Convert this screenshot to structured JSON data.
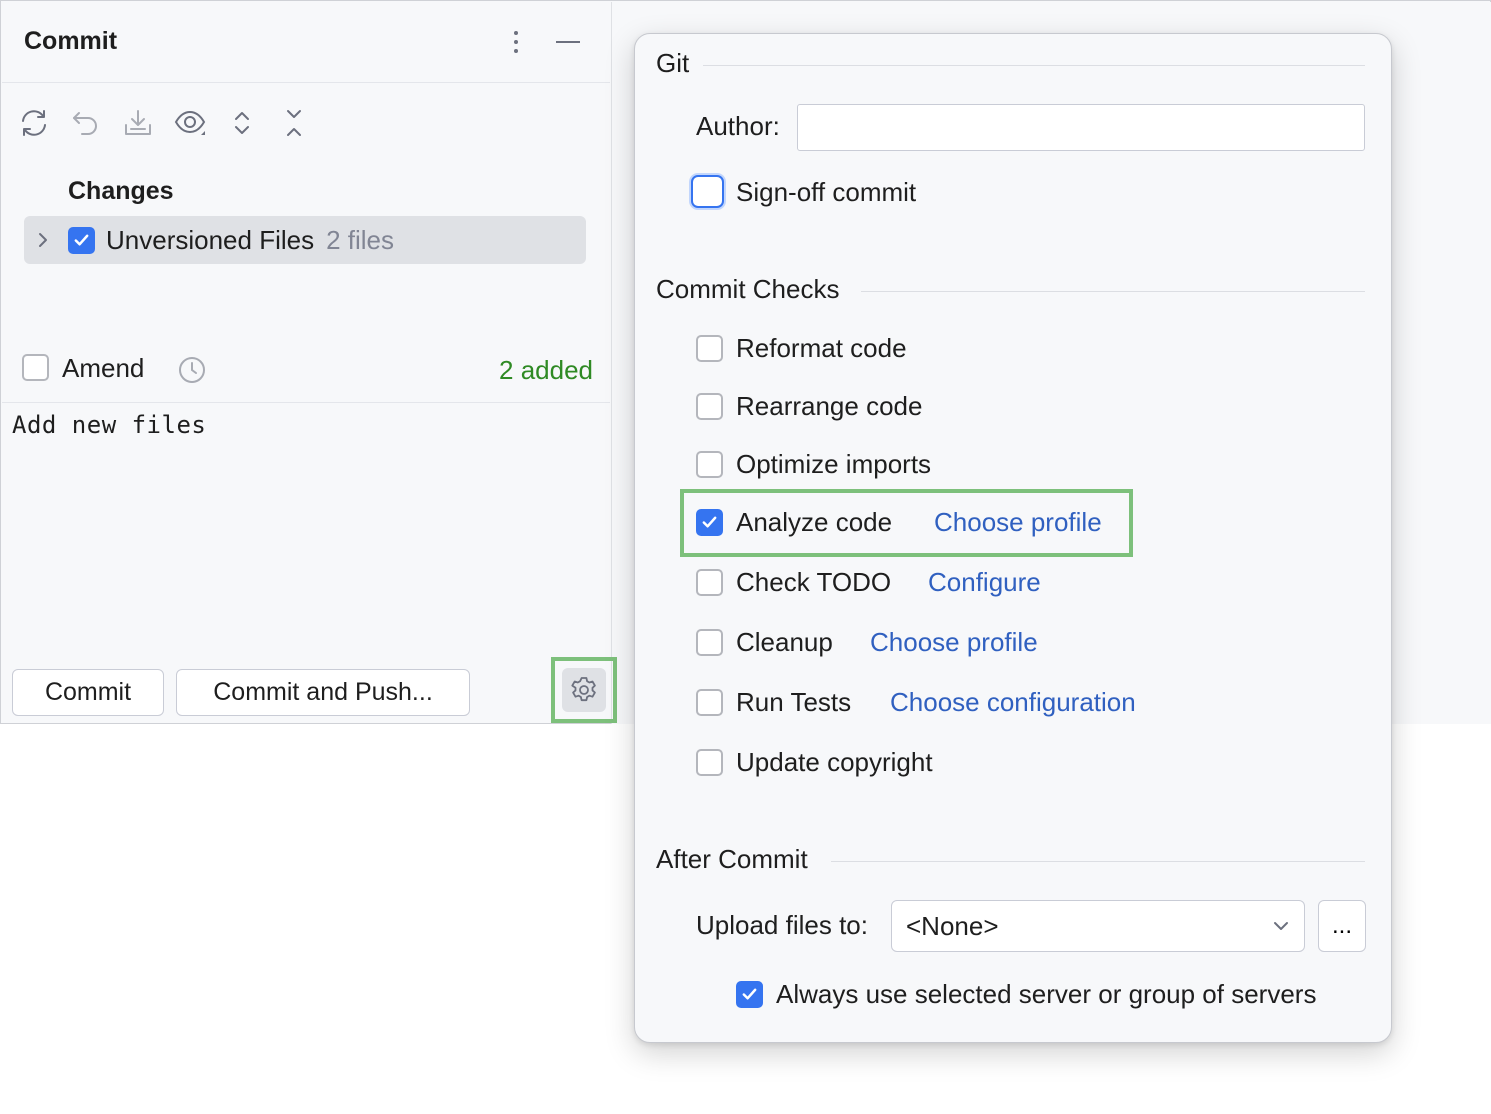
{
  "toolwindow": {
    "title": "Commit",
    "toolbar_icons": [
      "refresh-icon",
      "rollback-icon",
      "shelve-icon",
      "show-diff-icon",
      "expand-all-icon",
      "collapse-all-icon"
    ],
    "changes_label": "Changes",
    "tree_row": {
      "label": "Unversioned Files",
      "count": "2 files",
      "checked": true
    },
    "amend_label": "Amend",
    "added_status": "2 added",
    "commit_message": "Add new files",
    "commit_button": "Commit",
    "commit_push_button": "Commit and Push...",
    "highlight_color": "#7dc07b"
  },
  "popup": {
    "git": {
      "title": "Git",
      "author_label": "Author:",
      "author_value": "",
      "signoff_label": "Sign-off commit",
      "signoff_checked": false
    },
    "checks": {
      "title": "Commit Checks",
      "items": [
        {
          "label": "Reformat code",
          "checked": false,
          "link": ""
        },
        {
          "label": "Rearrange code",
          "checked": false,
          "link": ""
        },
        {
          "label": "Optimize imports",
          "checked": false,
          "link": ""
        },
        {
          "label": "Analyze code",
          "checked": true,
          "link": "Choose profile"
        },
        {
          "label": "Check TODO",
          "checked": false,
          "link": "Configure"
        },
        {
          "label": "Cleanup",
          "checked": false,
          "link": "Choose profile"
        },
        {
          "label": "Run Tests",
          "checked": false,
          "link": "Choose configuration"
        },
        {
          "label": "Update copyright",
          "checked": false,
          "link": ""
        }
      ]
    },
    "after": {
      "title": "After Commit",
      "upload_label": "Upload files to:",
      "upload_value": "<None>",
      "more_button": "...",
      "always_label": "Always use selected server or group of servers",
      "always_checked": true
    },
    "accent_color": "#3574f0",
    "link_color": "#3060c0"
  }
}
